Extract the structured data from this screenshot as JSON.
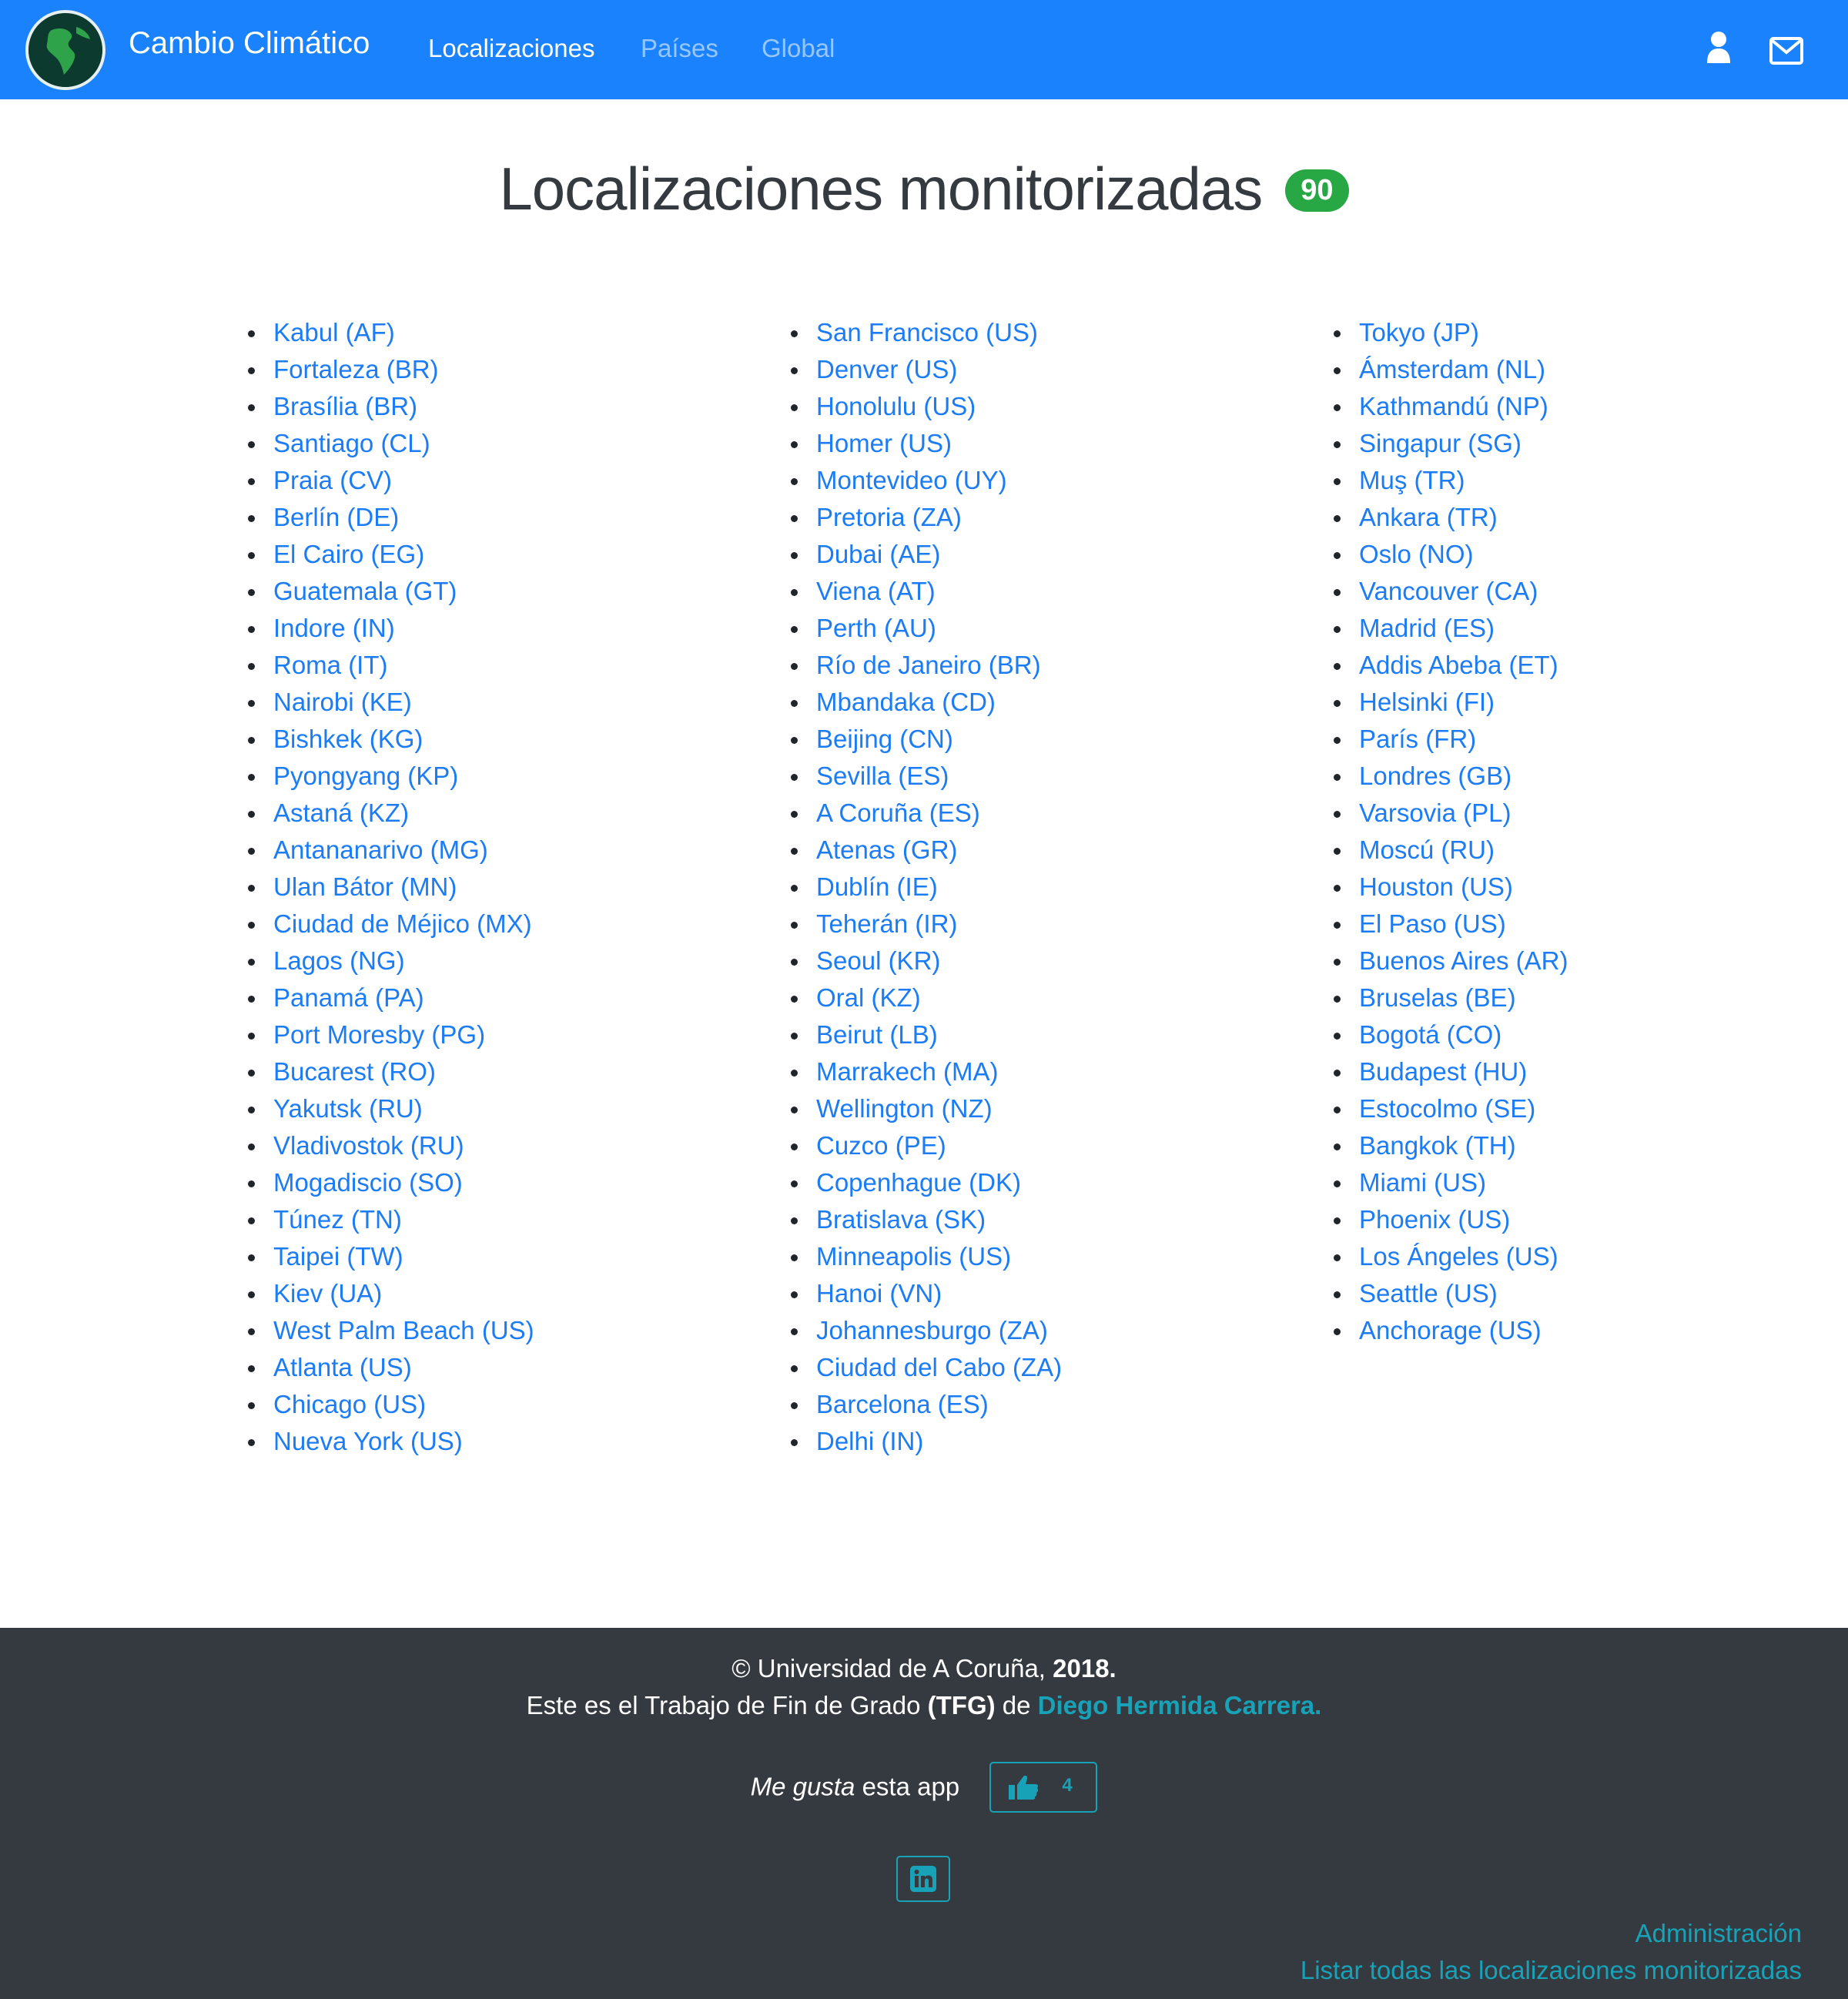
{
  "navbar": {
    "brand": "Cambio Climático",
    "links": [
      "Localizaciones",
      "Países",
      "Global"
    ],
    "logo_icon": "globe-icon",
    "user_icon": "user-icon",
    "mail_icon": "envelope-icon",
    "color": "#1b82fd"
  },
  "main": {
    "title": "Localizaciones monitorizadas",
    "count": "90",
    "columns": [
      [
        "Kabul (AF)",
        "Fortaleza (BR)",
        "Brasília (BR)",
        "Santiago (CL)",
        "Praia (CV)",
        "Berlín (DE)",
        "El Cairo (EG)",
        "Guatemala (GT)",
        "Indore (IN)",
        "Roma (IT)",
        "Nairobi (KE)",
        "Bishkek (KG)",
        "Pyongyang (KP)",
        "Astaná (KZ)",
        "Antananarivo (MG)",
        "Ulan Bátor (MN)",
        "Ciudad de Méjico (MX)",
        "Lagos (NG)",
        "Panamá (PA)",
        "Port Moresby (PG)",
        "Bucarest (RO)",
        "Yakutsk (RU)",
        "Vladivostok (RU)",
        "Mogadiscio (SO)",
        "Túnez (TN)",
        "Taipei (TW)",
        "Kiev (UA)",
        "West Palm Beach (US)",
        "Atlanta (US)",
        "Chicago (US)",
        "Nueva York (US)"
      ],
      [
        "San Francisco (US)",
        "Denver (US)",
        "Honolulu (US)",
        "Homer (US)",
        "Montevideo (UY)",
        "Pretoria (ZA)",
        "Dubai (AE)",
        "Viena (AT)",
        "Perth (AU)",
        "Río de Janeiro (BR)",
        "Mbandaka (CD)",
        "Beijing (CN)",
        "Sevilla (ES)",
        "A Coruña (ES)",
        "Atenas (GR)",
        "Dublín (IE)",
        "Teherán (IR)",
        "Seoul (KR)",
        "Oral (KZ)",
        "Beirut (LB)",
        "Marrakech (MA)",
        "Wellington (NZ)",
        "Cuzco (PE)",
        "Copenhague (DK)",
        "Bratislava (SK)",
        "Minneapolis (US)",
        "Hanoi (VN)",
        "Johannesburgo (ZA)",
        "Ciudad del Cabo (ZA)",
        "Barcelona (ES)",
        "Delhi (IN)"
      ],
      [
        "Tokyo (JP)",
        "Ámsterdam (NL)",
        "Kathmandú (NP)",
        "Singapur (SG)",
        "Muş (TR)",
        "Ankara (TR)",
        "Oslo (NO)",
        "Vancouver (CA)",
        "Madrid (ES)",
        "Addis Abeba (ET)",
        "Helsinki (FI)",
        "París (FR)",
        "Londres (GB)",
        "Varsovia (PL)",
        "Moscú (RU)",
        "Houston (US)",
        "El Paso (US)",
        "Buenos Aires (AR)",
        "Bruselas (BE)",
        "Bogotá (CO)",
        "Budapest (HU)",
        "Estocolmo (SE)",
        "Bangkok (TH)",
        "Miami (US)",
        "Phoenix (US)",
        "Los Ángeles (US)",
        "Seattle (US)",
        "Anchorage (US)"
      ]
    ]
  },
  "footer": {
    "copyright_prefix": "© Universidad de A Coruña,",
    "year": "2018.",
    "tfg_prefix": "Este es el Trabajo de Fin de Grado",
    "tfg_abbr": "(TFG)",
    "tfg_de": "de",
    "author": "Diego Hermida Carrera.",
    "like_em": "Me gusta",
    "like_rest": "esta app",
    "like_count": "4",
    "like_icon": "thumbs-up-icon",
    "linkedin_icon": "linkedin-icon",
    "admin_link": "Administración",
    "list_all_link": "Listar todas las localizaciones monitorizadas"
  }
}
